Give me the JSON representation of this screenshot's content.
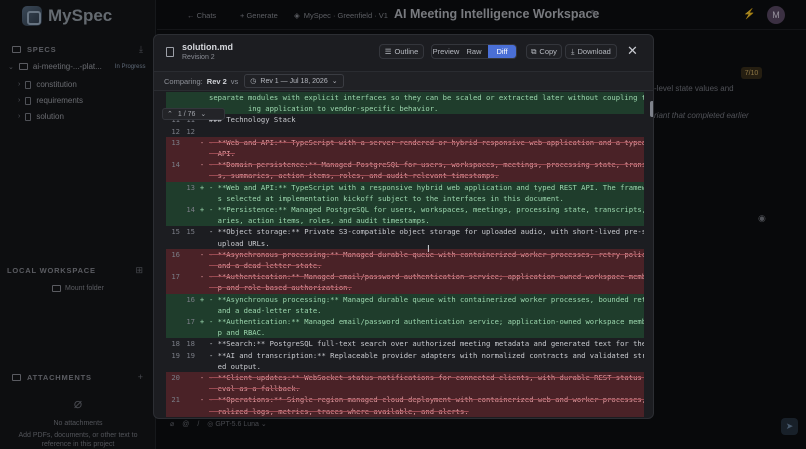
{
  "app": {
    "name": "MySpec"
  },
  "sidebar": {
    "specs_label": "SPECS",
    "project": {
      "name": "ai-meeting-...-plat...",
      "status": "In Progress"
    },
    "items": [
      {
        "label": "constitution"
      },
      {
        "label": "requirements"
      },
      {
        "label": "solution"
      }
    ],
    "local_workspace_label": "LOCAL WORKSPACE",
    "mount_folder": "Mount folder",
    "attachments_label": "ATTACHMENTS",
    "no_attachments": "No attachments",
    "attach_hint_1": "Add PDFs, documents, or other text to",
    "attach_hint_2": "reference in this project"
  },
  "topbar": {
    "chats": "← Chats",
    "generate": "+ Generate",
    "breadcrumb": "MySpec · Greenfield · V1",
    "title": "AI Meeting Intelligence Workspace",
    "avatar": "M"
  },
  "background": {
    "step_badge": "7/10",
    "text1": "-level state values and",
    "text2": "riant that completed earlier"
  },
  "modal": {
    "filename": "solution.md",
    "revision": "Revision 2",
    "outline": "Outline",
    "tabs": [
      "Preview",
      "Raw",
      "Diff"
    ],
    "active_tab": "Diff",
    "copy": "Copy",
    "download": "Download",
    "compare_label": "Comparing:",
    "rev_current": "Rev 2",
    "vs": "vs",
    "rev_other": "Rev 1 — Jul 18, 2026",
    "finder": "1 / 76",
    "diff_lines": [
      {
        "type": "add",
        "o": "",
        "n": "",
        "s": "",
        "t": "separate modules with explicit interfaces so they can be scaled or extracted later without coupling the us"
      },
      {
        "type": "add",
        "o": "",
        "n": "",
        "s": "",
        "t": "         ing application to vendor-specific behavior."
      },
      {
        "type": "ctx",
        "o": "",
        "n": "",
        "s": "",
        "t": ""
      },
      {
        "type": "ctx",
        "o": "11",
        "n": "11",
        "s": "",
        "t": "### Technology Stack"
      },
      {
        "type": "ctx",
        "o": "12",
        "n": "12",
        "s": "",
        "t": ""
      },
      {
        "type": "del",
        "o": "13",
        "n": "",
        "s": "-",
        "t": "- **Web and API:** TypeScript with a server-rendered or hybrid responsive web application and a typed REST"
      },
      {
        "type": "del",
        "o": "",
        "n": "",
        "s": "",
        "t": "  API."
      },
      {
        "type": "del",
        "o": "14",
        "n": "",
        "s": "-",
        "t": "- **Domain persistence:** Managed PostgreSQL for users, workspaces, meetings, processing state, transcript"
      },
      {
        "type": "del",
        "o": "",
        "n": "",
        "s": "",
        "t": "  s, summaries, action items, roles, and audit-relevant timestamps."
      },
      {
        "type": "add",
        "o": "",
        "n": "13",
        "s": "+",
        "t": "- **Web and API:** TypeScript with a responsive hybrid web application and typed REST API. The framework i"
      },
      {
        "type": "add",
        "o": "",
        "n": "",
        "s": "",
        "t": "  s selected at implementation kickoff subject to the interfaces in this document."
      },
      {
        "type": "add",
        "o": "",
        "n": "14",
        "s": "+",
        "t": "- **Persistence:** Managed PostgreSQL for users, workspaces, meetings, processing state, transcripts, summ"
      },
      {
        "type": "add",
        "o": "",
        "n": "",
        "s": "",
        "t": "  aries, action items, roles, and audit timestamps."
      },
      {
        "type": "ctx",
        "o": "15",
        "n": "15",
        "s": "",
        "t": "- **Object storage:** Private S3-compatible object storage for uploaded audio, with short-lived pre-signed"
      },
      {
        "type": "ctx",
        "o": "",
        "n": "",
        "s": "",
        "t": "  upload URLs."
      },
      {
        "type": "del",
        "o": "16",
        "n": "",
        "s": "-",
        "t": "- **Asynchronous processing:** Managed durable queue with containerized worker processes, retry policies,"
      },
      {
        "type": "del",
        "o": "",
        "n": "",
        "s": "",
        "t": "  and a dead-letter state."
      },
      {
        "type": "del",
        "o": "17",
        "n": "",
        "s": "-",
        "t": "- **Authentication:** Managed email/password authentication service; application-owned workspace membershi"
      },
      {
        "type": "del",
        "o": "",
        "n": "",
        "s": "",
        "t": "  p and role-based authorization."
      },
      {
        "type": "add",
        "o": "",
        "n": "16",
        "s": "+",
        "t": "- **Asynchronous processing:** Managed durable queue with containerized worker processes, bounded retries,"
      },
      {
        "type": "add",
        "o": "",
        "n": "",
        "s": "",
        "t": "  and a dead-letter state."
      },
      {
        "type": "add",
        "o": "",
        "n": "17",
        "s": "+",
        "t": "- **Authentication:** Managed email/password authentication service; application-owned workspace membershi"
      },
      {
        "type": "add",
        "o": "",
        "n": "",
        "s": "",
        "t": "  p and RBAC."
      },
      {
        "type": "ctx",
        "o": "18",
        "n": "18",
        "s": "",
        "t": "- **Search:** PostgreSQL full-text search over authorized meeting metadata and generated text for the MVP."
      },
      {
        "type": "ctx",
        "o": "19",
        "n": "19",
        "s": "",
        "t": "- **AI and transcription:** Replaceable provider adapters with normalized contracts and validated structur"
      },
      {
        "type": "ctx",
        "o": "",
        "n": "",
        "s": "",
        "t": "  ed output."
      },
      {
        "type": "del",
        "o": "20",
        "n": "",
        "s": "-",
        "t": "- **Client updates:** WebSocket status notifications for connected clients, with durable REST status retri"
      },
      {
        "type": "del",
        "o": "",
        "n": "",
        "s": "",
        "t": "  eval as a fallback."
      },
      {
        "type": "del",
        "o": "21",
        "n": "",
        "s": "-",
        "t": "- **Operations:** Single-region managed cloud deployment with containerized web and worker processes, cent"
      },
      {
        "type": "del",
        "o": "",
        "n": "",
        "s": "",
        "t": "  ralized logs, metrics, traces where available, and alerts."
      }
    ]
  },
  "composer": {
    "model": "GPT-5.6 Luna"
  },
  "colors": {
    "accent": "#4a6fd6",
    "added": "#1f3d2c",
    "removed": "#4a2227"
  }
}
